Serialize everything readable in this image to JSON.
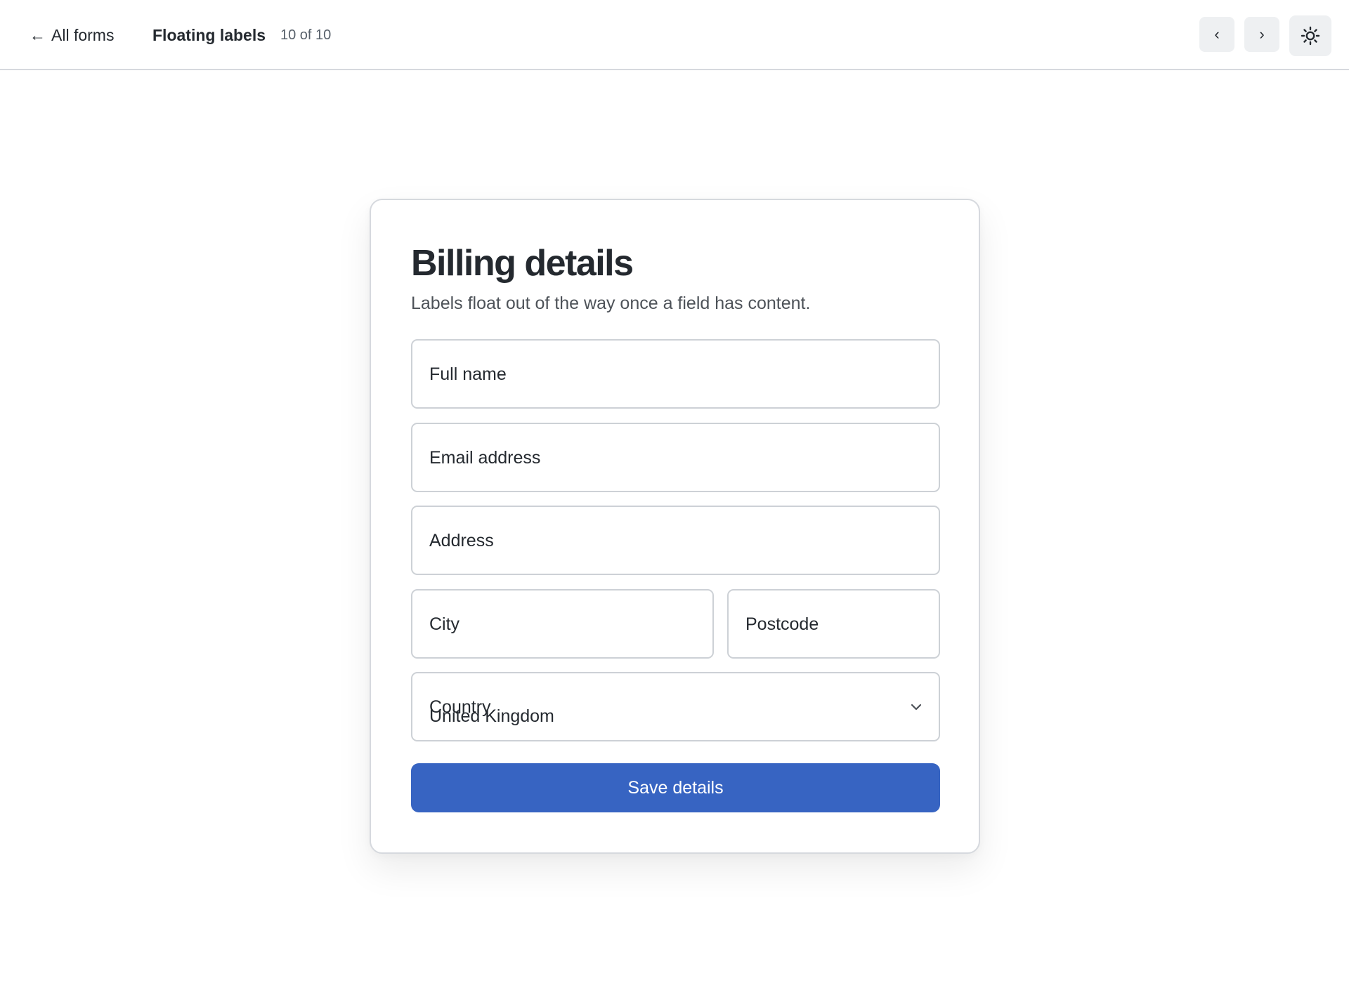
{
  "header": {
    "back_label": "All forms",
    "form_title": "Floating labels",
    "counter": "10 of 10",
    "prev_label": "‹",
    "next_label": "›"
  },
  "card": {
    "title": "Billing details",
    "subtitle": "Labels float out of the way once a field has content.",
    "fields": {
      "full_name": {
        "label": "Full name"
      },
      "email": {
        "label": "Email address"
      },
      "address": {
        "label": "Address"
      },
      "city": {
        "label": "City"
      },
      "postcode": {
        "label": "Postcode"
      },
      "country": {
        "label": "Country",
        "value": "United Kingdom"
      }
    },
    "submit_label": "Save details"
  },
  "colors": {
    "primary": "#3764c2",
    "border": "#cdd1d6",
    "text": "#24292f"
  },
  "icons": {
    "back": "arrow-left-icon",
    "theme": "sun-icon",
    "select": "chevron-down-icon"
  }
}
